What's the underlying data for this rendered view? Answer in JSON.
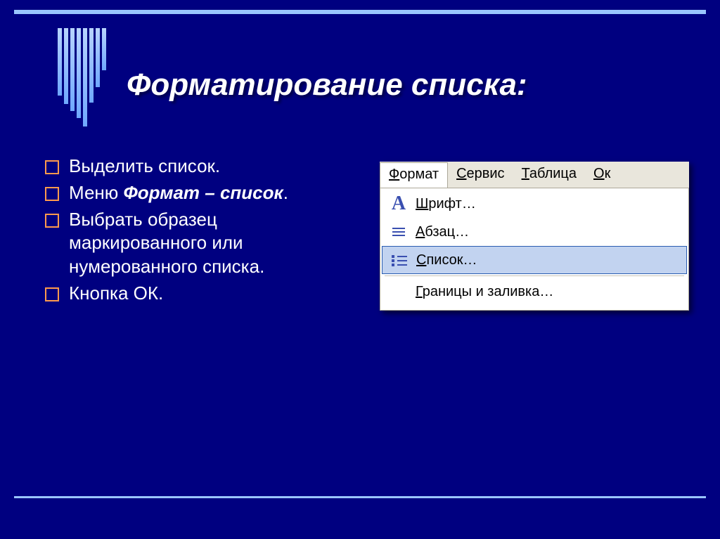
{
  "title": "Форматирование списка:",
  "bullets": [
    {
      "plain": "Выделить список."
    },
    {
      "before": "Меню ",
      "bold": "Формат – список",
      "after": "."
    },
    {
      "plain": "Выбрать образец маркированного или нумерованного списка."
    },
    {
      "plain": "Кнопка ОК."
    }
  ],
  "menubar": {
    "format_u": "Ф",
    "format_r": "ормат",
    "service_u": "С",
    "service_r": "ервис",
    "table_u": "Т",
    "table_r": "аблица",
    "window_u": "О",
    "window_r": "к"
  },
  "dropdown": {
    "font_u": "Ш",
    "font_r": "рифт…",
    "para_u": "А",
    "para_r": "бзац…",
    "list_u": "С",
    "list_r": "писок…",
    "border_u": "Г",
    "border_r": "раницы и заливка…"
  },
  "icons": {
    "font_letter": "A"
  }
}
